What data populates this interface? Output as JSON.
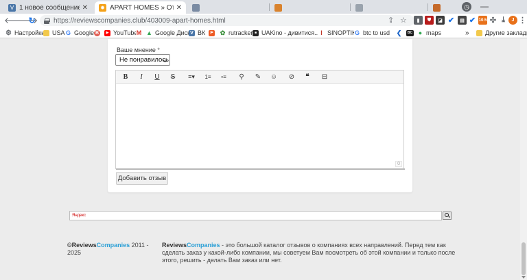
{
  "browser": {
    "tabs": [
      {
        "title": "1 новое сообщение",
        "favicon_color": "#4a76a8",
        "favicon_glyph": "V",
        "active": false
      },
      {
        "title": "APART HOMES » Отзывы и мнения",
        "favicon_color": "#f4a21a",
        "favicon_glyph": "✹",
        "active": true
      },
      {
        "title": "",
        "favicon_color": "#7a8ba3",
        "favicon_glyph": "",
        "active": false
      },
      {
        "title": "",
        "favicon_color": "#d9832e",
        "favicon_glyph": "",
        "active": false
      },
      {
        "title": "",
        "favicon_color": "#9aa3ad",
        "favicon_glyph": "",
        "active": false
      },
      {
        "title": "",
        "favicon_color": "#c56a2a",
        "favicon_glyph": "",
        "active": false
      }
    ],
    "url": "https://reviewscompanies.club/403009-apart-homes.html",
    "bookmarks": [
      {
        "label": "Настройки",
        "icon": "gear-icon",
        "color": "#5f6368",
        "glyph": "⚙"
      },
      {
        "label": "USA",
        "icon": "folder-icon",
        "color": "#f2c94c",
        "glyph": ""
      },
      {
        "label": "Google",
        "icon": "google-icon",
        "color": "#4285f4",
        "glyph": "G"
      },
      {
        "label": "",
        "icon": "bookmark-b-icon",
        "color": "#e05a4f",
        "glyph": "B"
      },
      {
        "label": "YouTube",
        "icon": "youtube-icon",
        "color": "#ff0000",
        "glyph": "▶"
      },
      {
        "label": "",
        "icon": "gmail-icon",
        "color": "#d93025",
        "glyph": "M"
      },
      {
        "label": "Google Диск",
        "icon": "drive-icon",
        "color": "#34a853",
        "glyph": "▲"
      },
      {
        "label": "ВК",
        "icon": "vk-icon",
        "color": "#4a76a8",
        "glyph": "V"
      },
      {
        "label": "",
        "icon": "bookmark-f-icon",
        "color": "#ee5a24",
        "glyph": "F"
      },
      {
        "label": "rutracker",
        "icon": "rutracker-icon",
        "color": "#3b8f3b",
        "glyph": "✿"
      },
      {
        "label": "UAKino - дивитися...",
        "icon": "uakino-icon",
        "color": "#222222",
        "glyph": "■"
      },
      {
        "label": "SINOPTIK",
        "icon": "thermometer-icon",
        "color": "#c0392b",
        "glyph": "I"
      },
      {
        "label": "btc to usd",
        "icon": "google-icon",
        "color": "#4285f4",
        "glyph": "G"
      },
      {
        "label": "",
        "icon": "bookmark-arrow-icon",
        "color": "#1e66c9",
        "glyph": "❮"
      },
      {
        "label": "",
        "icon": "bookmark-bc-icon",
        "color": "#1a1a1a",
        "glyph": "BC"
      },
      {
        "label": "maps",
        "icon": "maps-icon",
        "color": "#34a853",
        "glyph": "●"
      }
    ],
    "other_bookmarks": "Другие закладки",
    "overflow": "»"
  },
  "form": {
    "opinion_label": "Ваше мнение",
    "required_mark": "*",
    "opinion_value": "Не понравилось",
    "char_count": "0",
    "submit_label": "Добавить отзыв",
    "toolbar": [
      "B",
      "I",
      "U",
      "S",
      "≡▾",
      "1≡",
      "•≡",
      "⚲",
      "✎",
      "☺",
      "⊘",
      "❝",
      "⊟"
    ]
  },
  "search": {
    "placeholder": "Яндекс"
  },
  "footer": {
    "brand_part1": "©Reviews",
    "brand_part2": "Companies",
    "years": " 2011 - 2025",
    "desc_brand1": "Reviews",
    "desc_brand2": "Companies",
    "description": " - это большой каталог отзывов о компаниях всех направлений. Перед тем как сделать заказ у какой-либо компании, мы советуем Вам посмотреть об этой компании и только после этого, решить - делать Вам заказ или нет."
  }
}
